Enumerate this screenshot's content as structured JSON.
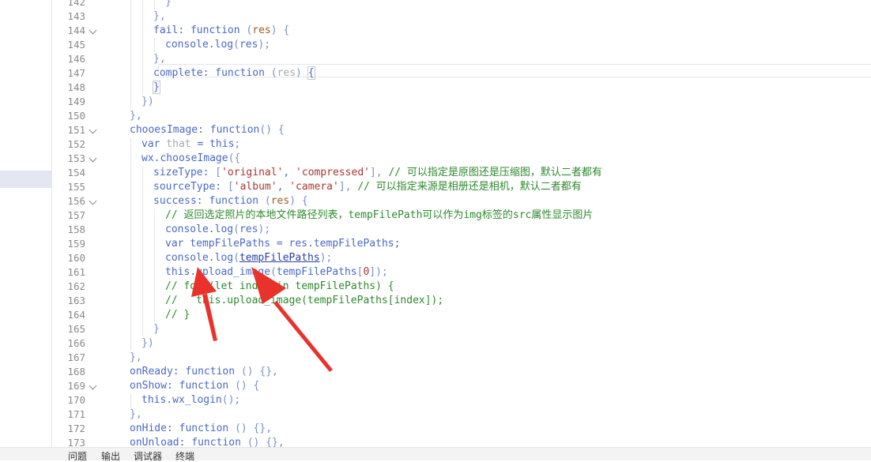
{
  "bottom_tabs": [
    "问题",
    "输出",
    "调试器",
    "终端"
  ],
  "colors": {
    "arrow": "#e8322b",
    "keyword": "#4b69c6",
    "string": "#448c27",
    "comment": "#2e8a2e"
  },
  "lines": [
    {
      "num": "142",
      "fold": false,
      "indent": 4,
      "tokens": [
        {
          "t": "}",
          "c": "b"
        }
      ]
    },
    {
      "num": "143",
      "fold": false,
      "indent": 3,
      "tokens": [
        {
          "t": "},",
          "c": "p"
        }
      ]
    },
    {
      "num": "144",
      "fold": true,
      "indent": 3,
      "tokens": [
        {
          "t": "fail",
          "c": "k"
        },
        {
          "t": ": ",
          "c": "k"
        },
        {
          "t": "function",
          "c": "k"
        },
        {
          "t": " (",
          "c": "p"
        },
        {
          "t": "res",
          "c": "n"
        },
        {
          "t": ") {",
          "c": "p"
        }
      ]
    },
    {
      "num": "145",
      "fold": false,
      "indent": 4,
      "tokens": [
        {
          "t": "console",
          "c": "k"
        },
        {
          "t": ".",
          "c": "k"
        },
        {
          "t": "log",
          "c": "k"
        },
        {
          "t": "(",
          "c": "p"
        },
        {
          "t": "res",
          "c": "k"
        },
        {
          "t": ");",
          "c": "p"
        }
      ]
    },
    {
      "num": "146",
      "fold": false,
      "indent": 3,
      "tokens": [
        {
          "t": "},",
          "c": "p"
        }
      ]
    },
    {
      "num": "147",
      "fold": false,
      "indent": 3,
      "tokens": [
        {
          "t": "complete",
          "c": "k"
        },
        {
          "t": ": ",
          "c": "k"
        },
        {
          "t": "function",
          "c": "k"
        },
        {
          "t": " (",
          "c": "p"
        },
        {
          "t": "res",
          "c": "g"
        },
        {
          "t": ") ",
          "c": "p"
        },
        {
          "t": "{",
          "c": "hl"
        }
      ]
    },
    {
      "num": "148",
      "fold": false,
      "indent": 3,
      "tokens": [
        {
          "t": "}",
          "c": "hl"
        }
      ]
    },
    {
      "num": "149",
      "fold": false,
      "indent": 2,
      "tokens": [
        {
          "t": "})",
          "c": "p"
        }
      ]
    },
    {
      "num": "150",
      "fold": false,
      "indent": 1,
      "tokens": [
        {
          "t": "},",
          "c": "p"
        }
      ]
    },
    {
      "num": "151",
      "fold": true,
      "indent": 1,
      "tokens": [
        {
          "t": "chooesImage",
          "c": "k"
        },
        {
          "t": ": ",
          "c": "k"
        },
        {
          "t": "function",
          "c": "k"
        },
        {
          "t": "() {",
          "c": "p"
        }
      ]
    },
    {
      "num": "152",
      "fold": false,
      "indent": 2,
      "tokens": [
        {
          "t": "var",
          "c": "k"
        },
        {
          "t": " that",
          "c": "g"
        },
        {
          "t": " = ",
          "c": "k"
        },
        {
          "t": "this",
          "c": "k"
        },
        {
          "t": ";",
          "c": "p"
        }
      ]
    },
    {
      "num": "153",
      "fold": true,
      "indent": 2,
      "tokens": [
        {
          "t": "wx",
          "c": "k"
        },
        {
          "t": ".",
          "c": "k"
        },
        {
          "t": "chooseImage",
          "c": "k"
        },
        {
          "t": "({",
          "c": "p"
        }
      ]
    },
    {
      "num": "154",
      "fold": false,
      "indent": 3,
      "tokens": [
        {
          "t": "sizeType",
          "c": "k"
        },
        {
          "t": ": ",
          "c": "k"
        },
        {
          "t": "[",
          "c": "p"
        },
        {
          "t": "'original'",
          "c": "f"
        },
        {
          "t": ", ",
          "c": "k"
        },
        {
          "t": "'compressed'",
          "c": "f"
        },
        {
          "t": "], ",
          "c": "p"
        },
        {
          "t": "// 可以指定是原图还是压缩图，默认二者都有",
          "c": "c"
        }
      ]
    },
    {
      "num": "155",
      "fold": false,
      "indent": 3,
      "tokens": [
        {
          "t": "sourceType",
          "c": "k"
        },
        {
          "t": ": ",
          "c": "k"
        },
        {
          "t": "[",
          "c": "p"
        },
        {
          "t": "'album'",
          "c": "f"
        },
        {
          "t": ", ",
          "c": "k"
        },
        {
          "t": "'camera'",
          "c": "f"
        },
        {
          "t": "], ",
          "c": "p"
        },
        {
          "t": "// 可以指定来源是相册还是相机，默认二者都有",
          "c": "c"
        }
      ]
    },
    {
      "num": "156",
      "fold": true,
      "indent": 3,
      "tokens": [
        {
          "t": "success",
          "c": "k"
        },
        {
          "t": ": ",
          "c": "k"
        },
        {
          "t": "function",
          "c": "k"
        },
        {
          "t": " (",
          "c": "p"
        },
        {
          "t": "res",
          "c": "n"
        },
        {
          "t": ") {",
          "c": "p"
        }
      ]
    },
    {
      "num": "157",
      "fold": false,
      "indent": 4,
      "tokens": [
        {
          "t": "// 返回选定照片的本地文件路径列表，tempFilePath可以作为img标签的src属性显示图片",
          "c": "c"
        }
      ]
    },
    {
      "num": "158",
      "fold": false,
      "indent": 4,
      "tokens": [
        {
          "t": "console",
          "c": "k"
        },
        {
          "t": ".",
          "c": "k"
        },
        {
          "t": "log",
          "c": "k"
        },
        {
          "t": "(",
          "c": "p"
        },
        {
          "t": "res",
          "c": "k"
        },
        {
          "t": ");",
          "c": "p"
        }
      ]
    },
    {
      "num": "159",
      "fold": false,
      "indent": 4,
      "tokens": [
        {
          "t": "var",
          "c": "k"
        },
        {
          "t": " tempFilePaths = res.tempFilePaths;",
          "c": "k"
        }
      ]
    },
    {
      "num": "160",
      "fold": false,
      "indent": 4,
      "tokens": [
        {
          "t": "console",
          "c": "k"
        },
        {
          "t": ".",
          "c": "k"
        },
        {
          "t": "log",
          "c": "k"
        },
        {
          "t": "(",
          "c": "p"
        },
        {
          "t": "tempFilePaths",
          "c": "u"
        },
        {
          "t": ");",
          "c": "p"
        }
      ]
    },
    {
      "num": "161",
      "fold": false,
      "indent": 4,
      "tokens": [
        {
          "t": "this",
          "c": "k"
        },
        {
          "t": ".upload_image",
          "c": "k"
        },
        {
          "t": "(",
          "c": "p"
        },
        {
          "t": "tempFilePaths",
          "c": "k"
        },
        {
          "t": "[",
          "c": "p"
        },
        {
          "t": "0",
          "c": "f"
        },
        {
          "t": "]);",
          "c": "p"
        }
      ]
    },
    {
      "num": "162",
      "fold": false,
      "indent": 4,
      "tokens": [
        {
          "t": "// for (",
          "c": "c"
        },
        {
          "t": "let",
          "c": "c"
        },
        {
          "t": " index in tempFilePaths) {",
          "c": "c"
        }
      ]
    },
    {
      "num": "163",
      "fold": false,
      "indent": 4,
      "tokens": [
        {
          "t": "//   this.upload_image(tempFilePaths[index]);",
          "c": "c"
        }
      ]
    },
    {
      "num": "164",
      "fold": false,
      "indent": 4,
      "tokens": [
        {
          "t": "// }",
          "c": "c"
        }
      ]
    },
    {
      "num": "165",
      "fold": false,
      "indent": 3,
      "tokens": [
        {
          "t": "}",
          "c": "p"
        }
      ]
    },
    {
      "num": "166",
      "fold": false,
      "indent": 2,
      "tokens": [
        {
          "t": "})",
          "c": "p"
        }
      ]
    },
    {
      "num": "167",
      "fold": false,
      "indent": 1,
      "tokens": [
        {
          "t": "},",
          "c": "p"
        }
      ]
    },
    {
      "num": "168",
      "fold": false,
      "indent": 1,
      "tokens": [
        {
          "t": "onReady",
          "c": "k"
        },
        {
          "t": ": ",
          "c": "k"
        },
        {
          "t": "function",
          "c": "k"
        },
        {
          "t": " () {},",
          "c": "p"
        }
      ]
    },
    {
      "num": "169",
      "fold": true,
      "indent": 1,
      "tokens": [
        {
          "t": "onShow",
          "c": "k"
        },
        {
          "t": ": ",
          "c": "k"
        },
        {
          "t": "function",
          "c": "k"
        },
        {
          "t": " () {",
          "c": "p"
        }
      ]
    },
    {
      "num": "170",
      "fold": false,
      "indent": 2,
      "tokens": [
        {
          "t": "this",
          "c": "k"
        },
        {
          "t": ".wx_login",
          "c": "k"
        },
        {
          "t": "();",
          "c": "p"
        }
      ]
    },
    {
      "num": "171",
      "fold": false,
      "indent": 1,
      "tokens": [
        {
          "t": "},",
          "c": "p"
        }
      ]
    },
    {
      "num": "172",
      "fold": false,
      "indent": 1,
      "tokens": [
        {
          "t": "onHide",
          "c": "k"
        },
        {
          "t": ": ",
          "c": "k"
        },
        {
          "t": "function",
          "c": "k"
        },
        {
          "t": " () {},",
          "c": "p"
        }
      ]
    },
    {
      "num": "173",
      "fold": false,
      "indent": 1,
      "tokens": [
        {
          "t": "onUnload",
          "c": "k"
        },
        {
          "t": ": ",
          "c": "k"
        },
        {
          "t": "function",
          "c": "k"
        },
        {
          "t": " () {},",
          "c": "p"
        }
      ]
    }
  ]
}
